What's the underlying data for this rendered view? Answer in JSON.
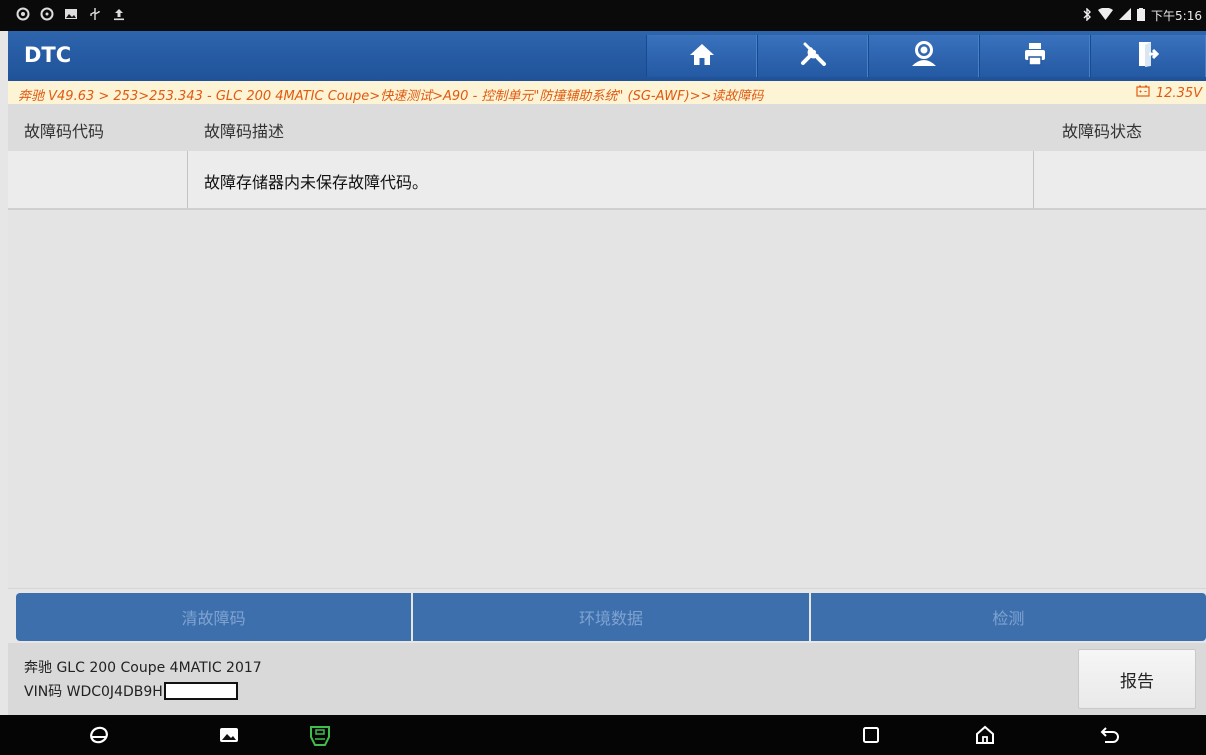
{
  "status_bar": {
    "left_icons": [
      "notification-icon",
      "notification-icon-2",
      "image-icon",
      "usb-icon",
      "upload-icon"
    ],
    "right_icons": [
      "bluetooth-icon",
      "wifi-icon",
      "signal-icon",
      "battery-icon"
    ],
    "time": "下午5:16"
  },
  "header": {
    "title": "DTC",
    "toolbar": [
      "home-icon",
      "tools-icon",
      "user-icon",
      "print-icon",
      "exit-icon"
    ]
  },
  "breadcrumb": {
    "path": "奔驰 V49.63 > 253>253.343 - GLC 200 4MATIC Coupe>快速测试>A90 - 控制单元\"防撞辅助系统\" (SG-AWF)>>读故障码",
    "voltage": "12.35V"
  },
  "table": {
    "headers": [
      "故障码代码",
      "故障码描述",
      "故障码状态"
    ],
    "rows": [
      {
        "code": "",
        "description": "故障存储器内未保存故障代码。",
        "status": ""
      }
    ]
  },
  "actions": {
    "clear_codes": "清故障码",
    "freeze_frame": "环境数据",
    "check": "检测"
  },
  "footer": {
    "vehicle": "奔驰 GLC 200 Coupe 4MATIC 2017",
    "vin_label": "VIN码 WDC0J4DB9H",
    "report_button": "报告"
  },
  "colors": {
    "header_blue": "#2459a3",
    "breadcrumb_text": "#e05a10",
    "breadcrumb_bg": "#fdf4d6",
    "button_blue": "#3e6fad",
    "vci_green": "#3fbf4a"
  }
}
